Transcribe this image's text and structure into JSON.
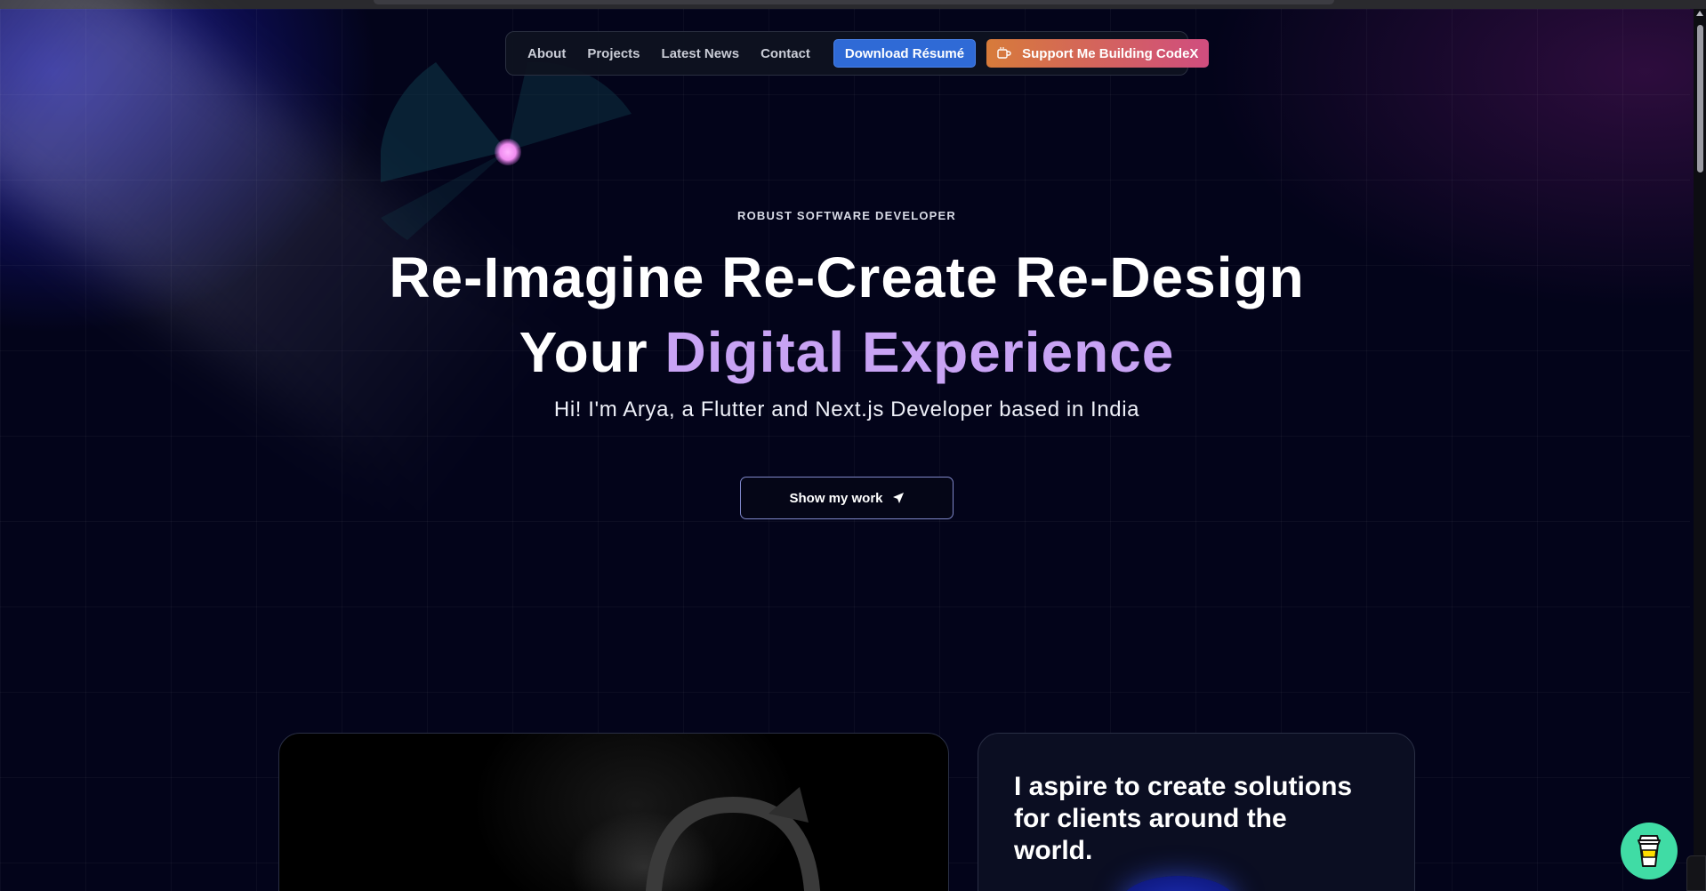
{
  "nav": {
    "links": [
      "About",
      "Projects",
      "Latest News",
      "Contact"
    ],
    "resume_label": "Download Résumé",
    "support_label": "Support Me Building CodeX"
  },
  "hero": {
    "eyebrow": "ROBUST SOFTWARE DEVELOPER",
    "headline_line1": "Re-Imagine Re-Create Re-Design",
    "headline_line2_prefix": "Your ",
    "headline_line2_accent": "Digital Experience",
    "subhead": "Hi! I'm Arya, a Flutter and Next.js Developer based in India",
    "cta_label": "Show my work"
  },
  "cards": {
    "right_title": "I aspire to create solutions for clients around the world."
  },
  "icons": {
    "support": "coffee-cup-icon",
    "cta": "send-arrow-icon",
    "floating": "buy-me-a-coffee-icon"
  },
  "colors": {
    "background": "#03041a",
    "accent_purple": "#c8a3f4",
    "resume_button": "#2f6ad6",
    "support_gradient_start": "#d77b3a",
    "support_gradient_end": "#d04d7f",
    "floating_button": "#40dca5",
    "radar_dot": "#f08cf0"
  }
}
